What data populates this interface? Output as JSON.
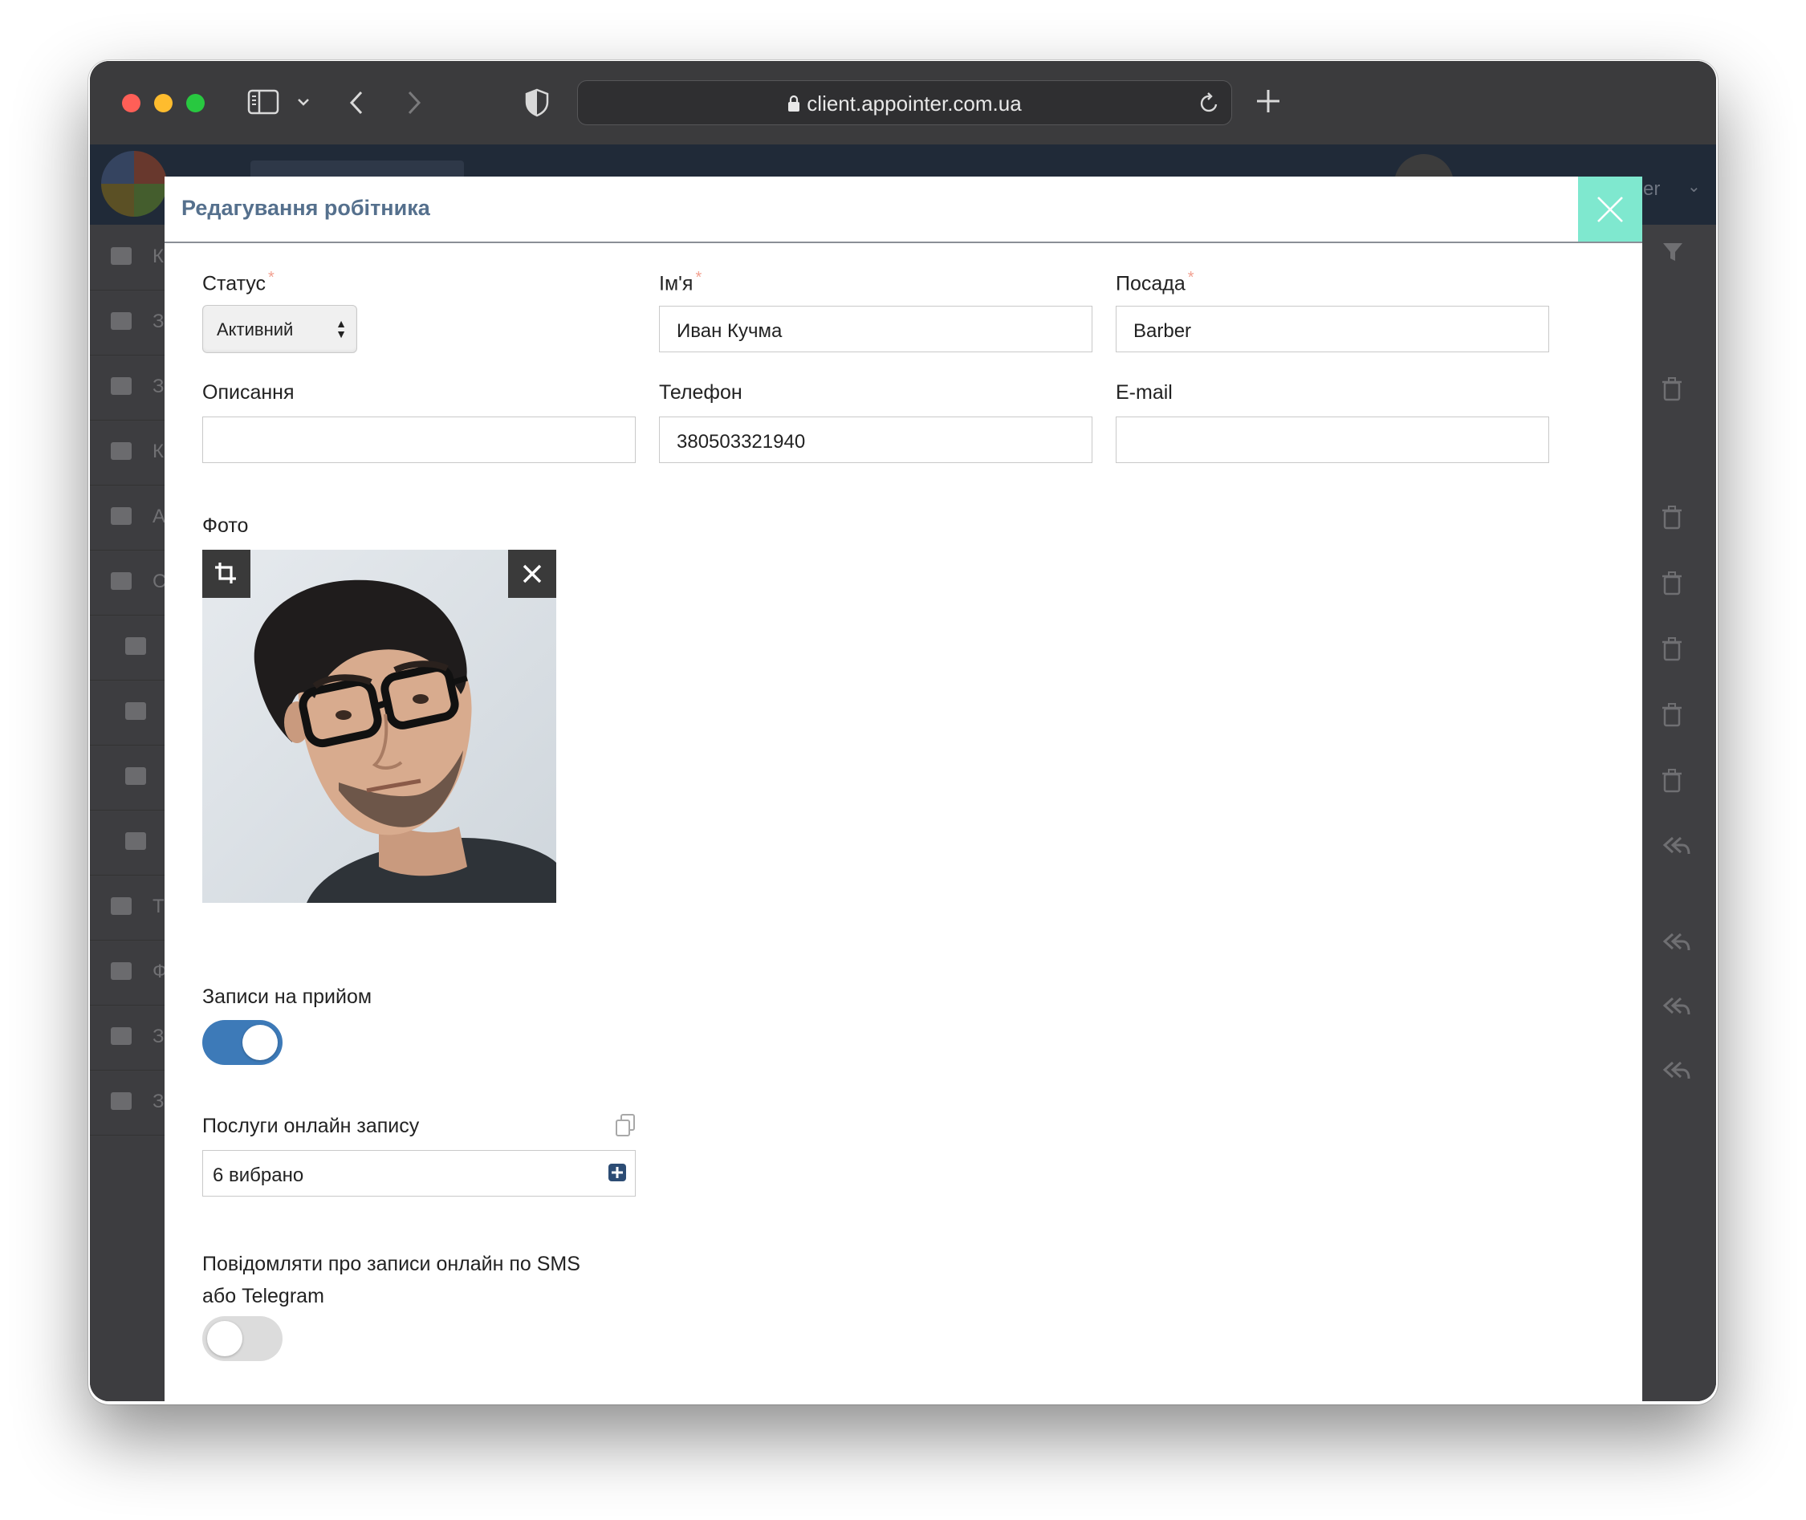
{
  "browser": {
    "url": "client.appointer.com.ua"
  },
  "app_header": {
    "user_partial": "er"
  },
  "sidebar_letters": [
    "К",
    "З",
    "З",
    "К",
    "А",
    "С",
    "Т",
    "Ф",
    "З",
    "З"
  ],
  "modal": {
    "title": "Редагування робітника",
    "fields": {
      "status": {
        "label": "Статус",
        "required_mark": "*",
        "value": "Активний"
      },
      "name": {
        "label": "Ім'я",
        "required_mark": "*",
        "value": "Иван Кучма"
      },
      "position": {
        "label": "Посада",
        "required_mark": "*",
        "value": "Barber"
      },
      "description": {
        "label": "Описання",
        "value": ""
      },
      "phone": {
        "label": "Телефон",
        "value": "380503321940"
      },
      "email": {
        "label": "E-mail",
        "value": ""
      }
    },
    "photo": {
      "label": "Фото"
    },
    "appointments": {
      "label": "Записи на прийом",
      "enabled": true
    },
    "online_services": {
      "label": "Послуги онлайн запису",
      "value": "6 вибрано"
    },
    "notify": {
      "label_line1": "Повідомляти про записи онлайн по SMS",
      "label_line2": "або Telegram",
      "enabled": false
    }
  },
  "colors": {
    "accent": "#3d7ab8",
    "title": "#55708d",
    "close_bg": "#7fe8cf",
    "required": "#f2a090",
    "toggle_off": "#dcdcdc"
  }
}
